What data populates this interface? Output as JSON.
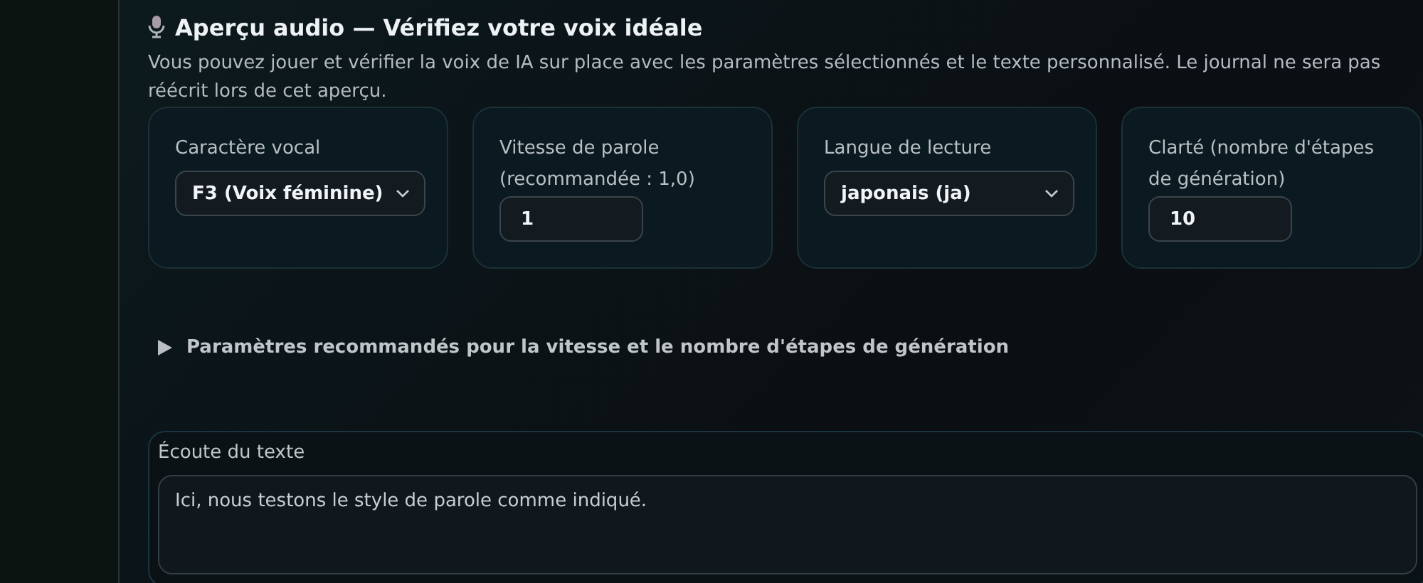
{
  "section": {
    "title": "Aperçu audio — Vérifiez votre voix idéale",
    "description": "Vous pouvez jouer et vérifier la voix de IA sur place avec les paramètres sélectionnés et le texte personnalisé. Le journal ne sera pas réécrit lors de cet aperçu."
  },
  "settings": [
    {
      "kind": "select",
      "label": "Caractère vocal",
      "value": "F3 (Voix féminine)"
    },
    {
      "kind": "number",
      "label": "Vitesse de parole (recommandée : 1,0)",
      "value": "1"
    },
    {
      "kind": "select",
      "label": "Langue de lecture",
      "value": "japonais (ja)"
    },
    {
      "kind": "number",
      "label": "Clarté (nombre d'étapes de génération)",
      "value": "10"
    }
  ],
  "details": {
    "summary": "Paramètres recommandés pour la vitesse et le nombre d'étapes de génération",
    "expanded": false
  },
  "text_preview": {
    "label": "Écoute du texte",
    "value": "Ici, nous testons le style de parole comme indiqué."
  }
}
